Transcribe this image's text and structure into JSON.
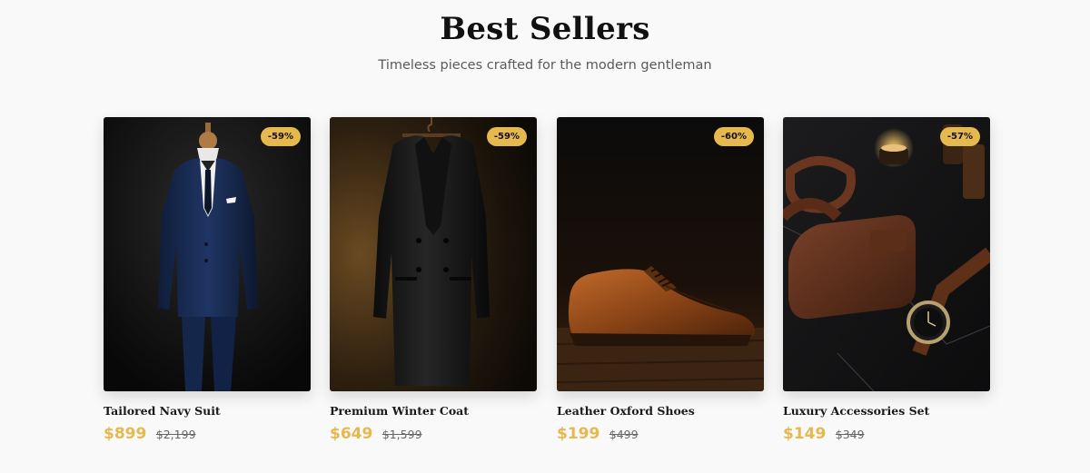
{
  "section": {
    "title": "Best Sellers",
    "subtitle": "Timeless pieces crafted for the modern gentleman"
  },
  "accent_color": "#e6b94f",
  "products": [
    {
      "name": "Tailored Navy Suit",
      "price": "$899",
      "old_price": "$2,199",
      "discount": "-59%",
      "image": "navy-suit-on-mannequin"
    },
    {
      "name": "Premium Winter Coat",
      "price": "$649",
      "old_price": "$1,599",
      "discount": "-59%",
      "image": "black-coat-on-hanger"
    },
    {
      "name": "Leather Oxford Shoes",
      "price": "$199",
      "old_price": "$499",
      "discount": "-60%",
      "image": "brown-oxford-shoe"
    },
    {
      "name": "Luxury Accessories Set",
      "price": "$149",
      "old_price": "$349",
      "discount": "-57%",
      "image": "wallet-belt-watch-set"
    }
  ]
}
